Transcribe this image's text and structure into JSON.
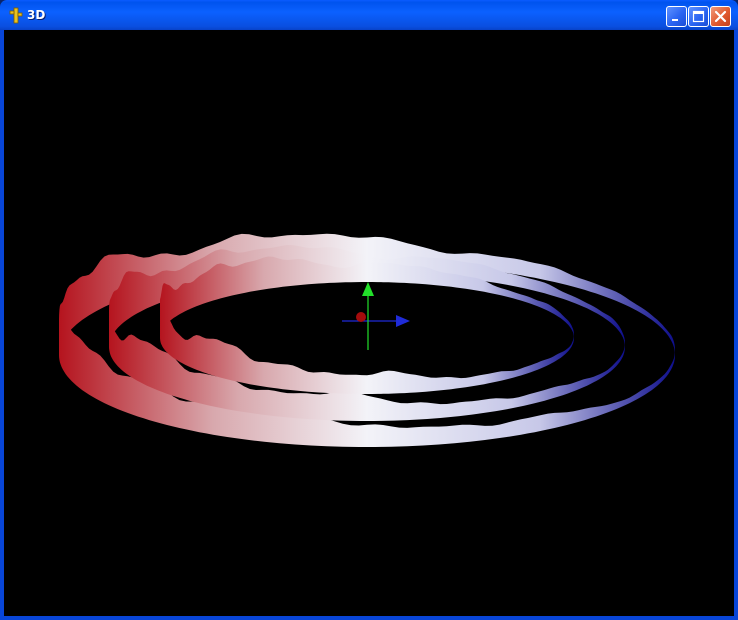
{
  "window": {
    "title": "3D",
    "app_icon": "cactus-icon",
    "buttons": [
      {
        "name": "minimize-button",
        "icon": "minimize-icon"
      },
      {
        "name": "maximize-button",
        "icon": "maximize-icon"
      },
      {
        "name": "close-button",
        "icon": "close-icon"
      }
    ]
  },
  "scene": {
    "background": "#000000",
    "ribbon_colors": {
      "warm": "#a30f1e",
      "mid": "#f2f2f7",
      "cool": "#12118f"
    },
    "axes": {
      "x_color": "#1f2bd8",
      "y_color": "#22e02a",
      "z_color": "#a40c0c"
    },
    "ribbons": 3
  }
}
